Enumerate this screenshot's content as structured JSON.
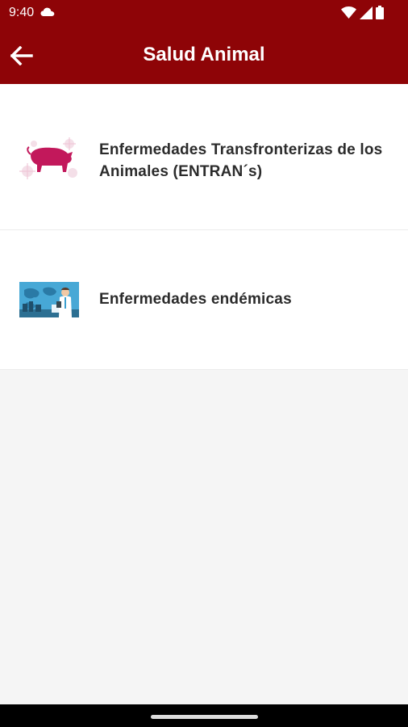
{
  "status_bar": {
    "time": "9:40",
    "icons": [
      "cloud-icon",
      "wifi-icon",
      "signal-icon",
      "battery-icon"
    ]
  },
  "app_bar": {
    "title": "Salud Animal",
    "back_icon": "arrow-left-icon",
    "background_color": "#8e0407"
  },
  "list": {
    "items": [
      {
        "label": "Enfermedades Transfronterizas de los Animales (ENTRAN´s)",
        "thumbnail": "pig-virus-icon"
      },
      {
        "label": "Enfermedades endémicas",
        "thumbnail": "veterinarian-world-icon"
      }
    ]
  }
}
